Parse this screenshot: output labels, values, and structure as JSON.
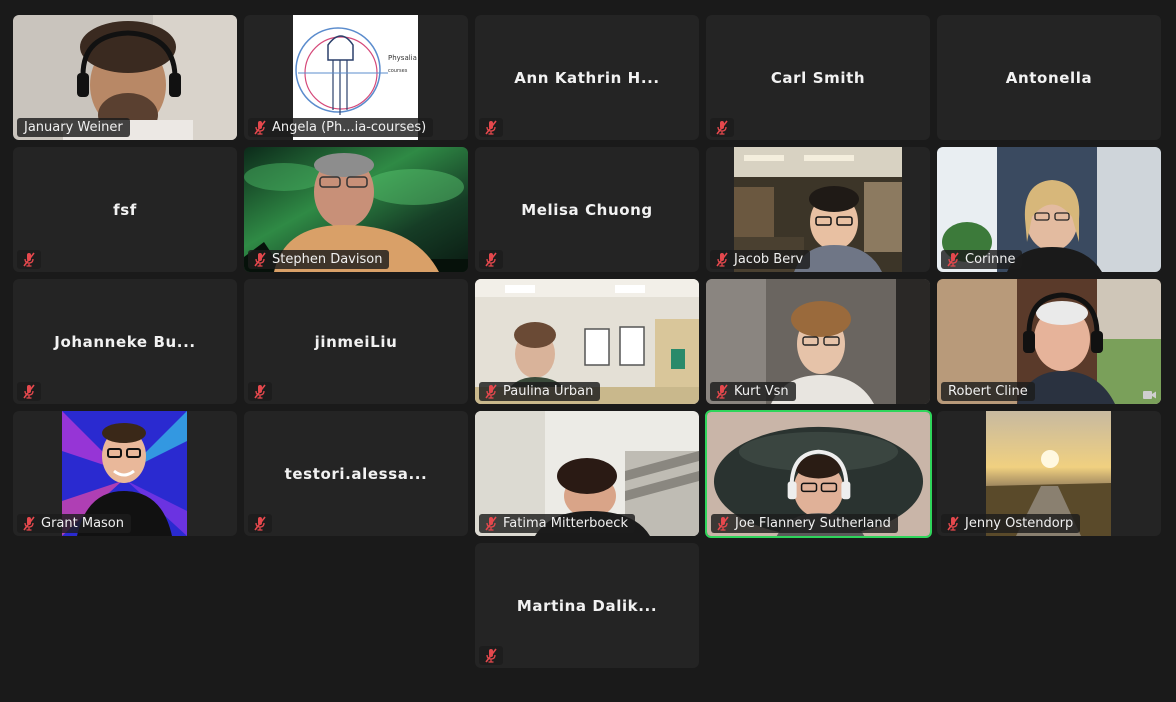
{
  "participants": [
    {
      "name": "January Weiner",
      "video": true,
      "muted": false
    },
    {
      "name": "Angela (Ph...ia-courses)",
      "video": true,
      "muted": true,
      "logo_text": [
        "Physalia",
        "courses"
      ]
    },
    {
      "name": "Ann Kathrin H...",
      "video": false,
      "muted": true
    },
    {
      "name": "Carl Smith",
      "video": false,
      "muted": true
    },
    {
      "name": "Antonella",
      "video": false,
      "muted": false
    },
    {
      "name": "fsf",
      "video": false,
      "muted": true
    },
    {
      "name": "Stephen Davison",
      "video": true,
      "muted": true
    },
    {
      "name": "Melisa Chuong",
      "video": false,
      "muted": true
    },
    {
      "name": "Jacob Berv",
      "video": true,
      "muted": true
    },
    {
      "name": "Corinne",
      "video": true,
      "muted": true
    },
    {
      "name": "Johanneke Bu...",
      "video": false,
      "muted": true
    },
    {
      "name": "jinmeiLiu",
      "video": false,
      "muted": true
    },
    {
      "name": "Paulina Urban",
      "video": true,
      "muted": true
    },
    {
      "name": "Kurt Vsn",
      "video": true,
      "muted": true
    },
    {
      "name": "Robert Cline",
      "video": true,
      "muted": false
    },
    {
      "name": "Grant Mason",
      "video": true,
      "muted": true
    },
    {
      "name": "testori.alessa...",
      "video": false,
      "muted": true
    },
    {
      "name": "Fatima Mitterboeck",
      "video": true,
      "muted": true
    },
    {
      "name": "Joe Flannery Sutherland",
      "video": true,
      "muted": true,
      "active_speaker": true
    },
    {
      "name": "Jenny Ostendorp",
      "video": true,
      "muted": true
    },
    {
      "name": "Martina Dalik...",
      "video": false,
      "muted": true
    }
  ],
  "colors": {
    "background": "#1a1a1a",
    "tile": "#242424",
    "active_border": "#2fd55b",
    "muted_icon": "#e5484d"
  },
  "icons": {
    "muted": "mic-muted-icon"
  }
}
